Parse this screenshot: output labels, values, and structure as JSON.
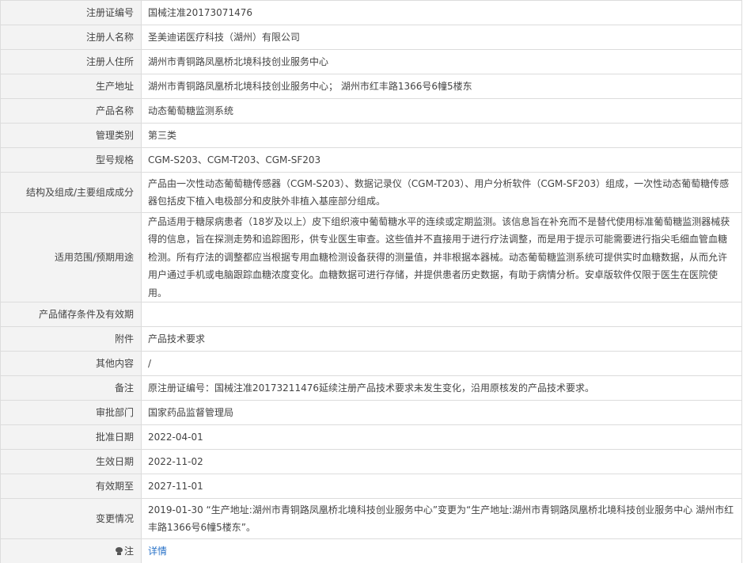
{
  "rows": [
    {
      "label": "注册证编号",
      "value": "国械注准20173071476"
    },
    {
      "label": "注册人名称",
      "value": "圣美迪诺医疗科技（湖州）有限公司"
    },
    {
      "label": "注册人住所",
      "value": "湖州市青铜路凤凰桥北境科技创业服务中心"
    },
    {
      "label": "生产地址",
      "value": "湖州市青铜路凤凰桥北境科技创业服务中心； 湖州市红丰路1366号6幢5楼东"
    },
    {
      "label": "产品名称",
      "value": "动态葡萄糖监测系统"
    },
    {
      "label": "管理类别",
      "value": "第三类"
    },
    {
      "label": "型号规格",
      "value": "CGM-S203、CGM-T203、CGM-SF203"
    },
    {
      "label": "结构及组成/主要组成成分",
      "value": "产品由一次性动态葡萄糖传感器（CGM-S203）、数据记录仪（CGM-T203）、用户分析软件（CGM-SF203）组成，一次性动态葡萄糖传感器包括皮下植入电极部分和皮肤外非植入基座部分组成。"
    },
    {
      "label": "适用范围/预期用途",
      "value": "产品适用于糖尿病患者（18岁及以上）皮下组织液中葡萄糖水平的连续或定期监测。该信息旨在补充而不是替代使用标准葡萄糖监测器械获得的信息，旨在探测走势和追踪图形，供专业医生审查。这些值并不直接用于进行疗法调整，而是用于提示可能需要进行指尖毛细血管血糖检测。所有疗法的调整都应当根据专用血糖检测设备获得的测量值，并非根据本器械。动态葡萄糖监测系统可提供实时血糖数据，从而允许用户通过手机或电脑跟踪血糖浓度变化。血糖数据可进行存储，并提供患者历史数据，有助于病情分析。安卓版软件仅限于医生在医院使用。"
    },
    {
      "label": "产品储存条件及有效期",
      "value": ""
    },
    {
      "label": "附件",
      "value": "产品技术要求"
    },
    {
      "label": "其他内容",
      "value": "/"
    },
    {
      "label": "备注",
      "value": "原注册证编号：国械注准20173211476延续注册产品技术要求未发生变化，沿用原核发的产品技术要求。"
    },
    {
      "label": "审批部门",
      "value": "国家药品监督管理局"
    },
    {
      "label": "批准日期",
      "value": "2022-04-01"
    },
    {
      "label": "生效日期",
      "value": "2022-11-02"
    },
    {
      "label": "有效期至",
      "value": "2027-11-01"
    },
    {
      "label": "变更情况",
      "value": "2019-01-30 “生产地址:湖州市青铜路凤凰桥北境科技创业服务中心”变更为“生产地址:湖州市青铜路凤凰桥北境科技创业服务中心 湖州市红丰路1366号6幢5楼东”。"
    }
  ],
  "note": {
    "label": "注",
    "link_text": "详情",
    "icon": "lightbulb-icon"
  }
}
